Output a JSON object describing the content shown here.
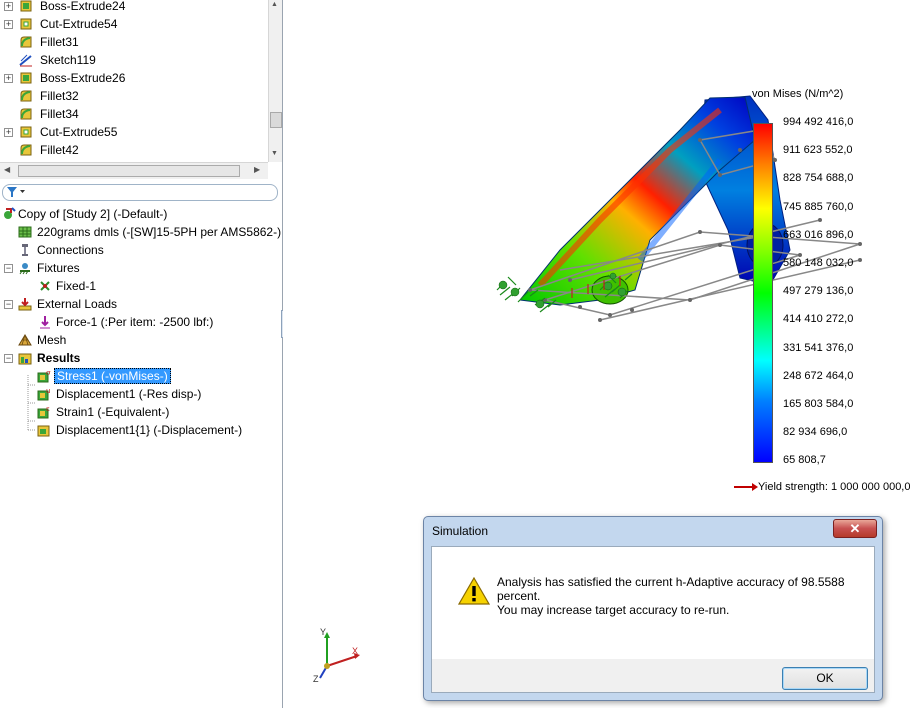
{
  "feature_tree": {
    "items": [
      {
        "label": "Boss-Extrude24",
        "expandable": true,
        "icon": "boss-extrude-icon"
      },
      {
        "label": "Cut-Extrude54",
        "expandable": true,
        "icon": "cut-extrude-icon"
      },
      {
        "label": "Fillet31",
        "expandable": false,
        "icon": "fillet-icon"
      },
      {
        "label": "Sketch119",
        "expandable": false,
        "icon": "sketch-icon"
      },
      {
        "label": "Boss-Extrude26",
        "expandable": true,
        "icon": "boss-extrude-icon"
      },
      {
        "label": "Fillet32",
        "expandable": false,
        "icon": "fillet-icon"
      },
      {
        "label": "Fillet34",
        "expandable": false,
        "icon": "fillet-icon"
      },
      {
        "label": "Cut-Extrude55",
        "expandable": true,
        "icon": "cut-extrude-icon"
      },
      {
        "label": "Fillet42",
        "expandable": false,
        "icon": "fillet-icon"
      }
    ]
  },
  "filter": {
    "icon": "filter-icon"
  },
  "sim_tree": {
    "study": "Copy of [Study 2] (-Default-)",
    "part": "220grams dmls (-[SW]15-5PH per AMS5862-)",
    "connections": "Connections",
    "fixtures": "Fixtures",
    "fixed": "Fixed-1",
    "external_loads": "External Loads",
    "force": "Force-1 (:Per item: -2500 lbf:)",
    "mesh": "Mesh",
    "results": "Results",
    "stress": "Stress1 (-vonMises-)",
    "displacement": "Displacement1 (-Res disp-)",
    "strain": "Strain1 (-Equivalent-)",
    "displacement2": "Displacement1{1} (-Displacement-)"
  },
  "legend": {
    "title": "von Mises (N/m^2)",
    "ticks": [
      "994 492 416,0",
      "911 623 552,0",
      "828 754 688,0",
      "745 885 760,0",
      "663 016 896,0",
      "580 148 032,0",
      "497 279 136,0",
      "414 410 272,0",
      "331 541 376,0",
      "248 672 464,0",
      "165 803 584,0",
      "82 934 696,0",
      "65 808,7"
    ],
    "yield": "Yield strength: 1 000 000 000,0"
  },
  "triad": {
    "x": "X",
    "y": "Y",
    "z": "Z"
  },
  "dialog": {
    "title": "Simulation",
    "close": "✕",
    "line1": "Analysis has satisfied the current h-Adaptive accuracy of 98.5588 percent.",
    "line2": "You may increase target accuracy to re-run.",
    "ok": "OK"
  }
}
